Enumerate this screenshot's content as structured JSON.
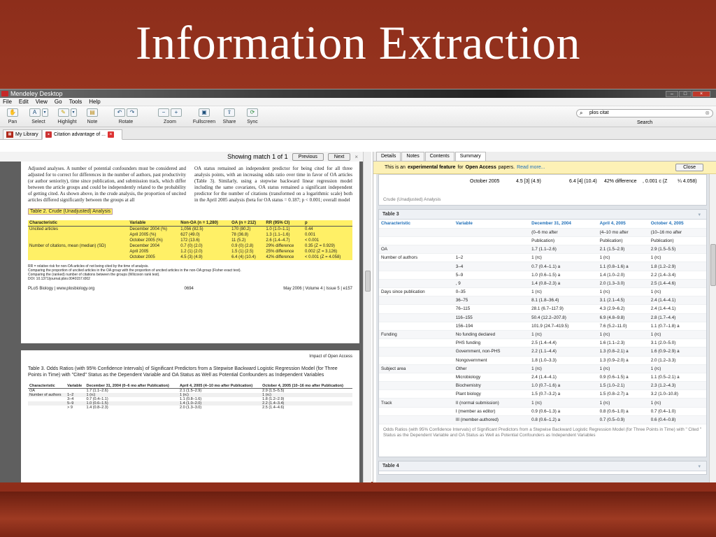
{
  "slide": {
    "title": "Information Extraction"
  },
  "window": {
    "title": "Mendeley Desktop",
    "controls": [
      "–",
      "□",
      "×"
    ]
  },
  "menu": [
    "File",
    "Edit",
    "View",
    "Go",
    "Tools",
    "Help"
  ],
  "toolbar": {
    "tools": [
      {
        "label": "Pan",
        "icon": "hand-icon"
      },
      {
        "label": "Select",
        "icon": "text-select-icon"
      },
      {
        "label": "Highlight",
        "icon": "highlighter-icon"
      },
      {
        "label": "Note",
        "icon": "note-icon"
      },
      {
        "label": "Rotate",
        "icon": "rotate-icon"
      },
      {
        "label": "Zoom",
        "icon": "zoom-icon"
      },
      {
        "label": "Fullscreen",
        "icon": "fullscreen-icon"
      },
      {
        "label": "Share",
        "icon": "share-icon"
      },
      {
        "label": "Sync",
        "icon": "sync-icon"
      }
    ],
    "search_value": "plos citat",
    "search_label": "Search"
  },
  "tabs": {
    "library": "My Library",
    "document": "Citation advantage of ..."
  },
  "find": {
    "status": "Showing match 1 of 1",
    "previous": "Previous",
    "next": "Next"
  },
  "pdf": {
    "para_left": "Adjusted analyses. A number of potential confounders must be considered and adjusted for to correct for differences in the number of authors, past productivity (or author seniority), time since publication, and submission track, which differ between the article groups and could be independently related to the probability of getting cited. As shown above, in the crude analysis, the proportion of uncited articles differed significantly between the groups at all",
    "para_right": "OA status remained an independent predictor for being cited for all three analysis points, with an increasing odds ratio over time in favor of OA articles (Table 3). Similarly, using a stepwise backward linear regression model including the same covariates, OA status remained a significant independent predictor for the number of citations (transformed on a logarithmic scale) both in the April 2005 analysis (beta for OA status = 0.187; p < 0.001; overall model",
    "table2_caption": "Table 2. Crude (Unadjusted) Analysis",
    "table2_headers": [
      "Characteristic",
      "Variable",
      "Non-OA (n = 1,280)",
      "OA (n = 212)",
      "RR (95% CI)",
      "p"
    ],
    "table2_rows": [
      [
        "Uncited articles",
        "December 2004 (%)",
        "1,056 (82.5)",
        "170 (80.2)",
        "1.0 (1.0–1.1)",
        "0.44"
      ],
      [
        "",
        "April 2005 (%)",
        "627 (49.0)",
        "78 (36.8)",
        "1.3 (1.1–1.6)",
        "0.001"
      ],
      [
        "",
        "October 2005 (%)",
        "172 (13.6)",
        "11 (5.2)",
        "2.6 (1.4–4.7)",
        "< 0.001"
      ],
      [
        "Number of citations, mean (median) (SD)",
        "December 2004",
        "0.7 (0) (2.0)",
        "0.9 (0) (2.8)",
        "29% difference",
        "0.35 (Z = 0.929)"
      ],
      [
        "",
        "April 2005",
        "1.2 (1) (2.0)",
        "1.5 (1) (2.5)",
        "25% difference",
        "0.002 (Z = 3.126)"
      ],
      [
        "",
        "October 2005",
        "4.5 (3) (4.9)",
        "6.4 (4) (10.4)",
        "42% difference",
        "< 0.001 (Z = 4.058)"
      ]
    ],
    "footnotes": [
      "RR = relative risk for non-OA articles of not being cited by the time of analysis.",
      "Comparing the proportion of uncited articles in the OA group with the proportion of uncited articles in the non-OA group (Fisher exact test).",
      "Comparing the (ranked) number of citations between the groups (Wilcoxon rank test).",
      "DOI: 10.1371/journal.pbio.0040157.t002"
    ],
    "footer_left": "PLoS Biology | www.plosbiology.org",
    "footer_mid": "0694",
    "footer_right": "May 2006 | Volume 4 | Issue 5 | e157",
    "page2_header": "Impact of Open Access",
    "table3_caption": "Table 3. Odds Ratios (with 95% Confidence Intervals) of Significant Predictors from a Stepwise Backward Logistic Regression Model (for Three Points in Time) with \"Cited\" Status as the Dependent Variable and OA Status as Well as Potential Confounders as Independent Variables",
    "table3_headers": [
      "Characteristic",
      "Variable",
      "December 31, 2004 (0–6 mo after Publication)",
      "April 4, 2005 (4–10 mo after Publication)",
      "October 4, 2005 (10–16 mo after Publication)"
    ],
    "table3_rows": [
      [
        "OA",
        "",
        "1.7 (1.1–2.6)",
        "2.1 (1.5–2.9)",
        "2.9 (1.5–5.5)"
      ],
      [
        "Number of authors",
        "1–2",
        "1 (rc)",
        "1 (rc)",
        "1 (rc)"
      ],
      [
        "",
        "3–4",
        "0.7 (0.4–1.1)",
        "1.1 (0.8–1.6)",
        "1.8 (1.2–2.9)"
      ],
      [
        "",
        "5–9",
        "1.0 (0.6–1.5)",
        "1.4 (1.0–2.0)",
        "2.2 (1.4–3.4)"
      ],
      [
        "",
        "> 9",
        "1.4 (0.8–2.3)",
        "2.0 (1.3–3.0)",
        "2.5 (1.4–4.6)"
      ]
    ]
  },
  "details": {
    "tabs": [
      "Details",
      "Notes",
      "Contents",
      "Summary"
    ],
    "notice_pre": "This is an",
    "notice_bold1": "experimental feature",
    "notice_mid": "for",
    "notice_bold2": "Open Access",
    "notice_post": "papers.",
    "notice_link": "Read more...",
    "notice_close": "Close",
    "card1_row": [
      "October 2005",
      "4.5 [3] (4.9)",
      "6.4 [4] (10.4)",
      "42% difference",
      ", 0.001 c (Z",
      "¼ 4.058)"
    ],
    "card1_caption": "Crude (Unadjusted) Analysis",
    "table3_title": "Table 3",
    "table3_headers": [
      "Characteristic",
      "Variable",
      "December 31, 2004",
      "April 4, 2005",
      "October 4, 2005"
    ],
    "table3_rows": [
      [
        "",
        "",
        "(0–6 mo after",
        "(4–10 mo after",
        "(10–16 mo after"
      ],
      [
        "",
        "",
        "Publication)",
        "Publication)",
        "Publication)"
      ],
      [
        "OA",
        "",
        "1.7 (1.1–2.6)",
        "2.1 (1.5–2.9)",
        "2.9 (1.5–5.5)"
      ],
      [
        "Number of authors",
        "1–2",
        "1 (rc)",
        "1 (rc)",
        "1 (rc)"
      ],
      [
        "",
        "3–4",
        "0.7 (0.4–1.1) a",
        "1.1 (0.8–1.6) a",
        "1.8 (1.2–2.9)"
      ],
      [
        "",
        "5–9",
        "1.0 (0.6–1.5) a",
        "1.4 (1.0–2.0)",
        "2.2 (1.4–3.4)"
      ],
      [
        "",
        ", 9",
        "1.4 (0.8–2.3) a",
        "2.0 (1.3–3.0)",
        "2.5 (1.4–4.6)"
      ],
      [
        "Days since publication",
        "0–35",
        "1 (rc)",
        "1 (rc)",
        "1 (rc)"
      ],
      [
        "",
        "36–75",
        "8.1 (1.8–36.4)",
        "3.1 (2.1–4.5)",
        "2.4 (1.4–4.1)"
      ],
      [
        "",
        "76–115",
        "28.1 (6.7–117.9)",
        "4.3 (2.9–6.2)",
        "2.4 (1.4–4.1)"
      ],
      [
        "",
        "116–155",
        "50.4 (12.2–207.8)",
        "6.9 (4.8–9.8)",
        "2.8 (1.7–4.4)"
      ],
      [
        "",
        "156–194",
        "101.9 (24.7–419.5)",
        "7.6 (5.2–11.0)",
        "1.1 (0.7–1.8) a"
      ],
      [
        "Funding",
        "No funding declared",
        "1 (rc)",
        "1 (rc)",
        "1 (rc)"
      ],
      [
        "",
        "PHS funding",
        "2.5 (1.4–4.4)",
        "1.6 (1.1–2.3)",
        "3.1 (2.0–5.0)"
      ],
      [
        "",
        "Government, non-PHS",
        "2.2 (1.1–4.4)",
        "1.3 (0.8–2.1) a",
        "1.6 (0.9–2.9) a"
      ],
      [
        "",
        "Nongovernment",
        "1.8 (1.0–3.3)",
        "1.3 (0.9–2.0) a",
        "2.0 (1.2–3.3)"
      ],
      [
        "Subject area",
        "Other",
        "1 (rc)",
        "1 (rc)",
        "1 (rc)"
      ],
      [
        "",
        "Microbiology",
        "2.4 (1.4–4.1)",
        "0.9 (0.6–1.5) a",
        "1.1 (0.5–2.1) a"
      ],
      [
        "",
        "Biochemistry",
        "1.0 (0.7–1.6) a",
        "1.5 (1.0–2.1)",
        "2.3 (1.2–4.3)"
      ],
      [
        "",
        "Plant biology",
        "1.5 (0.7–3.2) a",
        "1.5 (0.8–2.7) a",
        "3.2 (1.0–10.8)"
      ],
      [
        "Track",
        "II (normal submission)",
        "1 (rc)",
        "1 (rc)",
        "1 (rc)"
      ],
      [
        "",
        "I (member as editor)",
        "0.9 (0.6–1.3) a",
        "0.8 (0.6–1.0) a",
        "0.7 (0.4–1.0)"
      ],
      [
        "",
        "III (member-authored)",
        "0.8 (0.6–1.2) a",
        "0.7 (0.5–0.9)",
        "0.6 (0.4–0.8)"
      ]
    ],
    "table3_caption": "Odds Ratios (with 95% Confidence Intervals) of Significant Predictors from a Stepwise Backward Logistic Regression Model (for Three Points in Time) with \" Cited \" Status as the Dependent Variable and OA Status as Well as Potential Confounders as Independent Variables",
    "table4_title": "Table 4"
  }
}
